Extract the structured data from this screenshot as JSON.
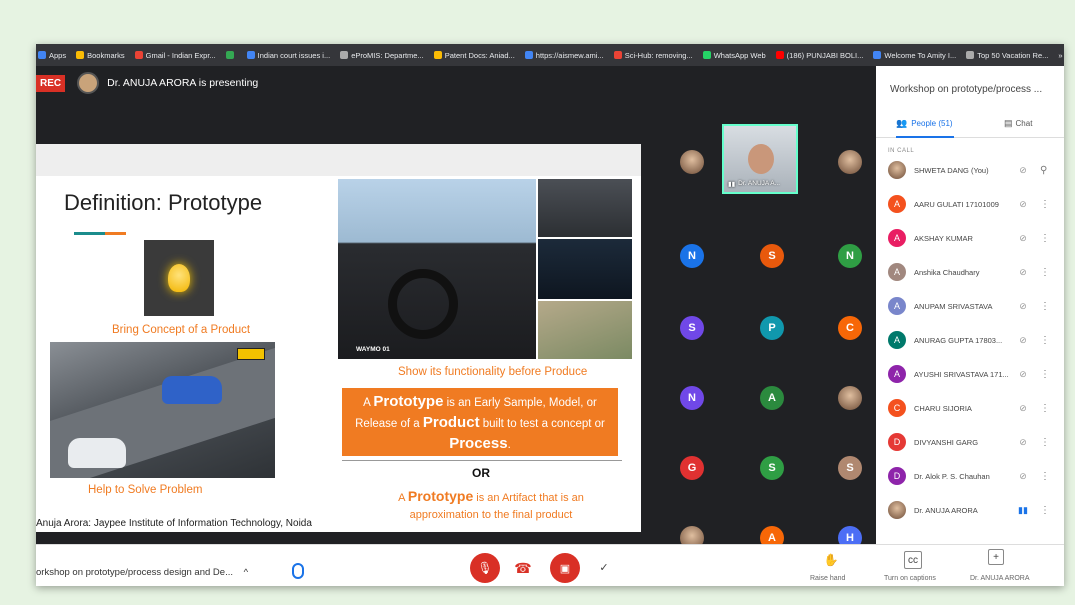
{
  "bookmarks": [
    {
      "label": "Apps",
      "color": "#4285f4"
    },
    {
      "label": "Bookmarks",
      "color": "#fbbc05"
    },
    {
      "label": "Gmail - Indian Expr...",
      "color": "#ea4335"
    },
    {
      "label": "",
      "color": "#34a853"
    },
    {
      "label": "Indian court issues i...",
      "color": "#4285f4"
    },
    {
      "label": "eProMIS: Departme...",
      "color": "#aaaaaa"
    },
    {
      "label": "Patent Docs: Aniad...",
      "color": "#fbbc05"
    },
    {
      "label": "https://aismew.ami...",
      "color": "#4285f4"
    },
    {
      "label": "Sci-Hub: removing...",
      "color": "#ea4335"
    },
    {
      "label": "WhatsApp Web",
      "color": "#25d366"
    },
    {
      "label": "(186) PUNJABI BOLI...",
      "color": "#ff0000"
    },
    {
      "label": "Welcome To Amity I...",
      "color": "#4285f4"
    },
    {
      "label": "Top 50 Vacation Re...",
      "color": "#aaaaaa"
    },
    {
      "label": "»",
      "color": ""
    },
    {
      "label": "Other bookm",
      "color": "#fbbc05"
    }
  ],
  "presenter": {
    "rec": "REC",
    "text": "Dr. ANUJA ARORA is presenting"
  },
  "slide": {
    "title": "Definition: Prototype",
    "bulb_caption": "Bring Concept of a Product",
    "car_caption": "Help to Solve Problem",
    "interior_label": "WAYMO 01",
    "interior_caption": "Show its functionality before Produce",
    "def1_a": "A ",
    "def1_b": "Prototype",
    "def1_c": " is an Early Sample, Model, or Release of a ",
    "def1_d": "Product",
    "def1_e": " built to test a concept or ",
    "def1_f": "Process",
    "def1_g": ".",
    "or": "OR",
    "def2_a": "A ",
    "def2_b": "Prototype",
    "def2_c": " is an Artifact that is an approximation to the final product",
    "credit": "Anuja Arora: Jaypee Institute of Information Technology, Noida"
  },
  "spotlight": {
    "name": "Dr. ANUJA A..."
  },
  "tiles": [
    {
      "letter": "",
      "color": "",
      "photo": true
    },
    {
      "letter": "",
      "color": "",
      "photo": true
    },
    {
      "letter": "N",
      "color": "#1a73e8"
    },
    {
      "letter": "S",
      "color": "#e8590c"
    },
    {
      "letter": "N",
      "color": "#2f9e44"
    },
    {
      "letter": "S",
      "color": "#7048e8"
    },
    {
      "letter": "P",
      "color": "#1098ad"
    },
    {
      "letter": "C",
      "color": "#f76707"
    },
    {
      "letter": "N",
      "color": "#7048e8"
    },
    {
      "letter": "A",
      "color": "#2b8a3e"
    },
    {
      "letter": "",
      "color": "",
      "photo": true
    },
    {
      "letter": "G",
      "color": "#e03131"
    },
    {
      "letter": "S",
      "color": "#2f9e44"
    },
    {
      "letter": "S",
      "color": "#b08870"
    },
    {
      "letter": "",
      "color": "",
      "photo": true
    },
    {
      "letter": "A",
      "color": "#f76707"
    },
    {
      "letter": "H",
      "color": "#4c6ef5"
    }
  ],
  "panel": {
    "title": "Workshop on prototype/process ...",
    "people_tab": "People (51)",
    "chat_tab": "Chat",
    "in_call": "IN CALL",
    "people": [
      {
        "initial": "",
        "name": "SHWETA DANG (You)",
        "color": "#b08870",
        "photo": true
      },
      {
        "initial": "A",
        "name": "AARU GULATI 17101009",
        "color": "#f4511e"
      },
      {
        "initial": "A",
        "name": "AKSHAY KUMAR",
        "color": "#e91e63"
      },
      {
        "initial": "A",
        "name": "Anshika Chaudhary",
        "color": "#a1887f"
      },
      {
        "initial": "A",
        "name": "ANUPAM SRIVASTAVA",
        "color": "#7986cb"
      },
      {
        "initial": "A",
        "name": "ANURAG GUPTA 17803...",
        "color": "#00796b"
      },
      {
        "initial": "A",
        "name": "AYUSHI SRIVASTAVA 171...",
        "color": "#8e24aa"
      },
      {
        "initial": "C",
        "name": "CHARU SIJORIA",
        "color": "#f4511e"
      },
      {
        "initial": "D",
        "name": "DIVYANSHI GARG",
        "color": "#e53935"
      },
      {
        "initial": "D",
        "name": "Dr. Alok P. S. Chauhan",
        "color": "#8e24aa"
      },
      {
        "initial": "",
        "name": "Dr. ANUJA ARORA",
        "color": "#8d6e63",
        "photo": true
      }
    ]
  },
  "bottom": {
    "meeting": "orkshop on prototype/process design and De...",
    "raise_hand": "Raise hand",
    "captions": "Turn on captions",
    "presenter_label": "Dr. ANUJA ARORA"
  }
}
